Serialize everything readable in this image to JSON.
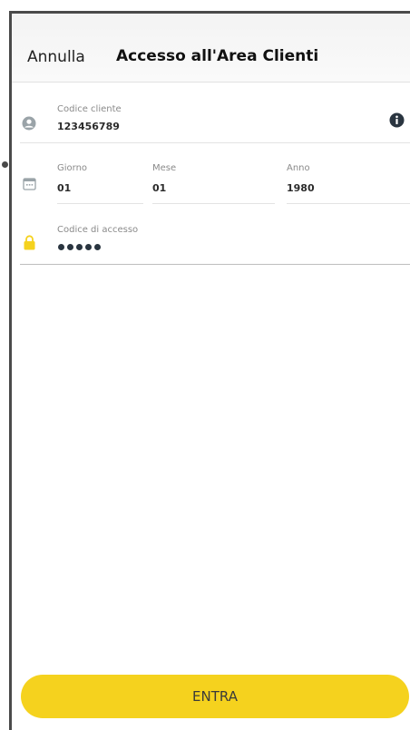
{
  "header": {
    "cancel_label": "Annulla",
    "title": "Accesso all'Area Clienti"
  },
  "form": {
    "customer_code": {
      "label": "Codice cliente",
      "value": "123456789",
      "icon": "user-icon"
    },
    "info_icon": "info-icon",
    "birth_date": {
      "icon": "calendar-icon",
      "day": {
        "label": "Giorno",
        "value": "01"
      },
      "month": {
        "label": "Mese",
        "value": "01"
      },
      "year": {
        "label": "Anno",
        "value": "1980"
      }
    },
    "access_code": {
      "label": "Codice di accesso",
      "masked_length": 5,
      "icon": "lock-icon"
    }
  },
  "footer": {
    "enter_label": "ENTRA"
  },
  "colors": {
    "accent": "#f5d21e",
    "icon_gray": "#9aa3a8",
    "icon_dark": "#2a3540"
  }
}
